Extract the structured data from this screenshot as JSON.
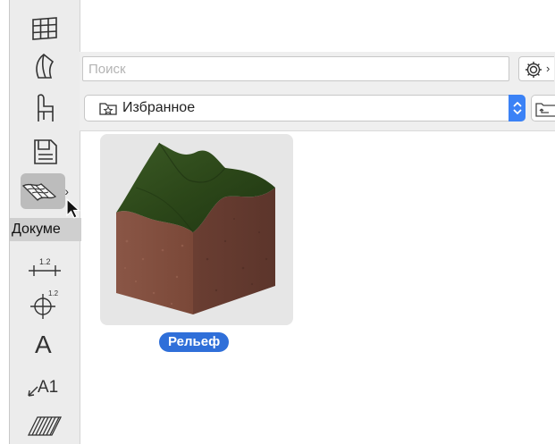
{
  "toolbox": {
    "tools": [
      {
        "name": "grid-icon"
      },
      {
        "name": "shell-icon"
      },
      {
        "name": "chair-icon"
      },
      {
        "name": "document-icon"
      },
      {
        "name": "mesh-icon",
        "selected": true
      },
      {
        "name": "dimension-icon"
      },
      {
        "name": "level-dimension-icon"
      },
      {
        "name": "text-icon"
      },
      {
        "name": "label-icon"
      },
      {
        "name": "fill-icon"
      }
    ],
    "section_label": "Докуме",
    "dimension_value": "1.2",
    "level_value": "1.2",
    "text_glyph": "A",
    "label_glyph": "A1"
  },
  "search": {
    "placeholder": "Поиск",
    "value": ""
  },
  "folder": {
    "selected": "Избранное"
  },
  "items": [
    {
      "label": "Рельеф",
      "icon": "terrain-mesh-icon"
    }
  ],
  "colors": {
    "accent": "#2f6fd9",
    "toolbox_bg": "#ececec",
    "thumb_bg": "#e6e6e6",
    "grass": "#2f4a1e",
    "soil": "#7a4a3a"
  }
}
